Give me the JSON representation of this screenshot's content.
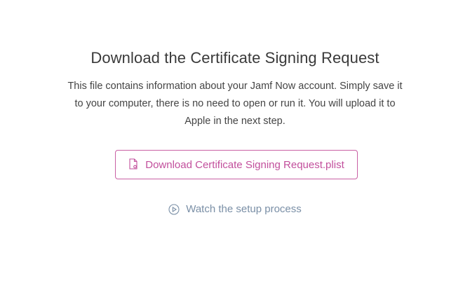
{
  "title": "Download the Certificate Signing Request",
  "description": "This file contains information about your Jamf Now account. Simply save it to your computer, there is no need to open or run it. You will upload it to Apple in the next step.",
  "download_button": {
    "label": "Download Certificate Signing Request.plist",
    "icon": "file-gear-icon"
  },
  "watch_link": {
    "label": "Watch the setup process",
    "icon": "play-circle-icon"
  },
  "colors": {
    "accent": "#c24f9c",
    "link": "#7a8fa6",
    "text": "#444444"
  }
}
